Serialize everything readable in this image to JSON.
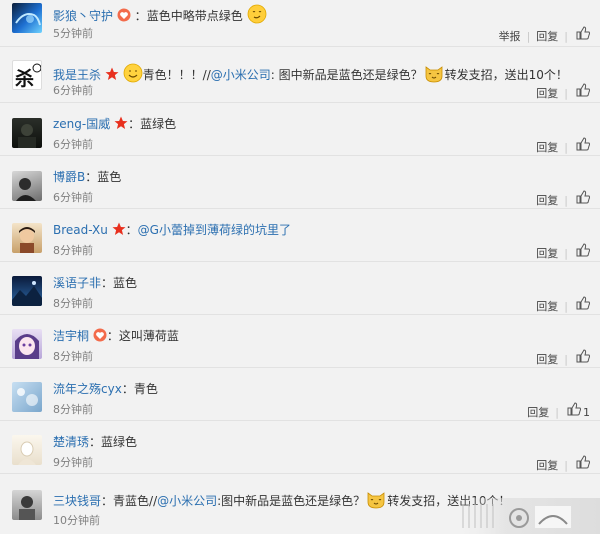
{
  "actions": {
    "report": "举报",
    "reply": "回复"
  },
  "comments": [
    {
      "user": "影狼丶守护",
      "colon": "：",
      "parts": [
        {
          "t": "蓝色中略带点绿色",
          "c": "text"
        }
      ],
      "time": "5分钟前",
      "report": true
    },
    {
      "user": "我是王杀",
      "colon": "",
      "parts": [
        {
          "t": "青色！！！//",
          "c": "text"
        },
        {
          "t": "@小米公司",
          "c": "link"
        },
        {
          "t": ": 图中新品是蓝色还是绿色？",
          "c": "text"
        },
        {
          "t": "转发支招，送出10个！",
          "c": "text"
        }
      ],
      "time": "6分钟前"
    },
    {
      "user": "zeng-国威",
      "colon": "：",
      "parts": [
        {
          "t": "蓝绿色",
          "c": "text"
        }
      ],
      "time": "6分钟前"
    },
    {
      "user": "博爵B",
      "colon": "：",
      "parts": [
        {
          "t": "蓝色",
          "c": "text"
        }
      ],
      "time": "6分钟前"
    },
    {
      "user": "Bread-Xu",
      "colon": "：",
      "parts": [
        {
          "t": "@G小蕾掉到薄荷绿的坑里了",
          "c": "link"
        }
      ],
      "time": "8分钟前"
    },
    {
      "user": "溪语子非",
      "colon": "：",
      "parts": [
        {
          "t": "蓝色",
          "c": "text"
        }
      ],
      "time": "8分钟前"
    },
    {
      "user": "洁宇桐",
      "colon": "：",
      "parts": [
        {
          "t": "这叫薄荷蓝",
          "c": "text"
        }
      ],
      "time": "8分钟前"
    },
    {
      "user": "流年之殇cyx",
      "colon": "：",
      "parts": [
        {
          "t": "青色",
          "c": "text"
        }
      ],
      "time": "8分钟前",
      "likes": "1"
    },
    {
      "user": "楚清琇",
      "colon": "：",
      "parts": [
        {
          "t": "蓝绿色",
          "c": "text"
        }
      ],
      "time": "9分钟前"
    },
    {
      "user": "三块钱哥",
      "colon": "：",
      "parts": [
        {
          "t": "青蓝色//",
          "c": "text"
        },
        {
          "t": "@小米公司",
          "c": "link"
        },
        {
          "t": ":图中新品是蓝色还是绿色？",
          "c": "text"
        },
        {
          "t": "转发支招，送出10个！",
          "c": "text"
        }
      ],
      "time": "10分钟前"
    }
  ]
}
